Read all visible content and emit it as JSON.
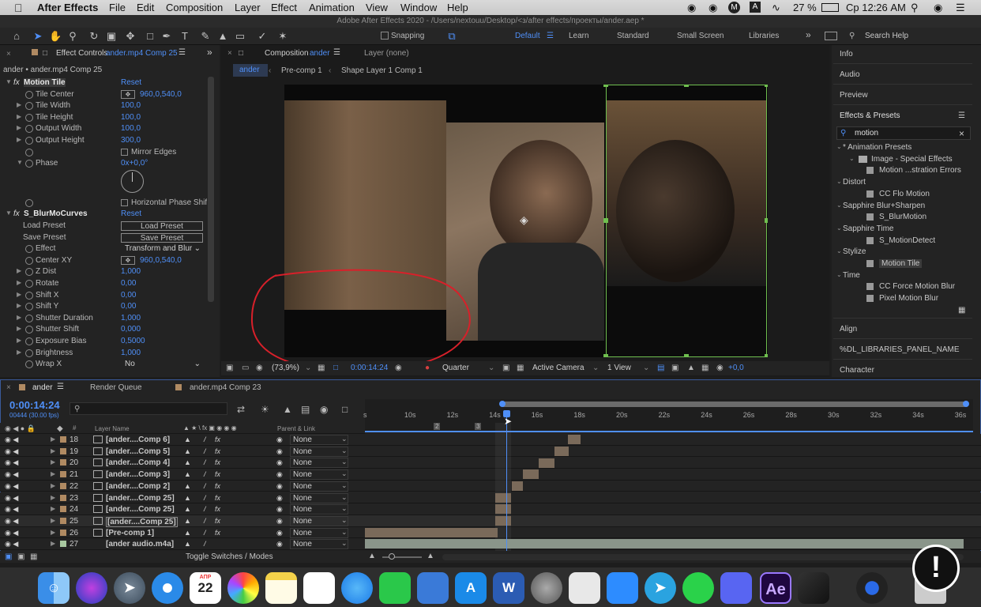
{
  "menubar": {
    "apple": "",
    "app": "After Effects",
    "items": [
      "File",
      "Edit",
      "Composition",
      "Layer",
      "Effect",
      "Animation",
      "View",
      "Window",
      "Help"
    ],
    "battery": "27 %",
    "clock": "Ср 12:26 AM",
    "m_icon": "M",
    "a_icon": "A"
  },
  "window_title": "Adobe After Effects 2020 - /Users/nextouu/Desktop/<з/after effects/проекты/ander.aep *",
  "toolbar": {
    "snapping": "Snapping",
    "workspaces": [
      "Default",
      "Learn",
      "Standard",
      "Small Screen",
      "Libraries"
    ],
    "active_workspace": "Default",
    "search_help": "Search Help"
  },
  "effect_controls": {
    "tab": "Effect Controls",
    "tab_file": "ander.mp4 Comp 25",
    "subtitle": "ander • ander.mp4 Comp 25",
    "fx1": {
      "name": "Motion Tile",
      "reset": "Reset",
      "props": [
        {
          "label": "Tile Center",
          "value": "960,0,540,0"
        },
        {
          "label": "Tile Width",
          "value": "100,0"
        },
        {
          "label": "Tile Height",
          "value": "100,0"
        },
        {
          "label": "Output Width",
          "value": "100,0"
        },
        {
          "label": "Output Height",
          "value": "300,0"
        },
        {
          "label": "Mirror Edges",
          "value": ""
        },
        {
          "label": "Phase",
          "value": "0x+0,0°"
        },
        {
          "label": "Horizontal Phase Shif",
          "value": ""
        }
      ]
    },
    "fx2": {
      "name": "S_BlurMoCurves",
      "reset": "Reset",
      "props": [
        {
          "label": "Load Preset",
          "value": "Load Preset"
        },
        {
          "label": "Save Preset",
          "value": "Save Preset"
        },
        {
          "label": "Effect",
          "value": "Transform and Blur"
        },
        {
          "label": "Center XY",
          "value": "960,0,540,0"
        },
        {
          "label": "Z Dist",
          "value": "1,000"
        },
        {
          "label": "Rotate",
          "value": "0,00"
        },
        {
          "label": "Shift X",
          "value": "0,00"
        },
        {
          "label": "Shift Y",
          "value": "0,00"
        },
        {
          "label": "Shutter Duration",
          "value": "1,000"
        },
        {
          "label": "Shutter Shift",
          "value": "0,000"
        },
        {
          "label": "Exposure Bias",
          "value": "0,5000"
        },
        {
          "label": "Brightness",
          "value": "1,000"
        },
        {
          "label": "Wrap X",
          "value": "No"
        }
      ]
    }
  },
  "composition": {
    "tab": "Composition",
    "tab_name": "ander",
    "layer_tab": "Layer (none)",
    "breadcrumbs": [
      "ander",
      "Pre-comp 1",
      "Shape Layer 1 Comp 1"
    ],
    "zoom": "(73,9%)",
    "timecode": "0:00:14:24",
    "resolution": "Quarter",
    "camera": "Active Camera",
    "views": "1 View",
    "exposure": "+0,0"
  },
  "right_panel": {
    "items": [
      "Info",
      "Audio",
      "Preview",
      "Effects & Presets",
      "Align",
      "%DL_LIBRARIES_PANEL_NAME",
      "Character"
    ],
    "search": "motion",
    "tree": [
      {
        "t": "* Animation Presets",
        "lvl": 0
      },
      {
        "t": "Image - Special Effects",
        "lvl": 1
      },
      {
        "t": "Motion ...stration Errors",
        "lvl": 2
      },
      {
        "t": "Distort",
        "lvl": 0
      },
      {
        "t": "CC Flo Motion",
        "lvl": 2
      },
      {
        "t": "Sapphire Blur+Sharpen",
        "lvl": 0
      },
      {
        "t": "S_BlurMotion",
        "lvl": 2
      },
      {
        "t": "Sapphire Time",
        "lvl": 0
      },
      {
        "t": "S_MotionDetect",
        "lvl": 2
      },
      {
        "t": "Stylize",
        "lvl": 0
      },
      {
        "t": "Motion Tile",
        "lvl": 2
      },
      {
        "t": "Time",
        "lvl": 0
      },
      {
        "t": "CC Force Motion Blur",
        "lvl": 2
      },
      {
        "t": "Pixel Motion Blur",
        "lvl": 2
      }
    ]
  },
  "timeline": {
    "tabs": [
      "ander",
      "Render Queue",
      "ander.mp4 Comp 23"
    ],
    "timecode": "0:00:14:24",
    "frames": "00444 (30.00 fps)",
    "col_layer": "Layer Name",
    "col_parent": "Parent & Link",
    "col_num": "#",
    "ruler": [
      "10s",
      "12s",
      "14s",
      "16s",
      "18s",
      "20s",
      "22s",
      "24s",
      "26s",
      "28s",
      "30s",
      "32s",
      "34s",
      "36s"
    ],
    "ruler_start": "s",
    "markers": [
      "2",
      "3"
    ],
    "layers": [
      {
        "num": "18",
        "name": "[ander....Comp 6]",
        "parent": "None",
        "color": "#b08a62"
      },
      {
        "num": "19",
        "name": "[ander....Comp 5]",
        "parent": "None",
        "color": "#b08a62"
      },
      {
        "num": "20",
        "name": "[ander....Comp 4]",
        "parent": "None",
        "color": "#b08a62"
      },
      {
        "num": "21",
        "name": "[ander....Comp 3]",
        "parent": "None",
        "color": "#b08a62"
      },
      {
        "num": "22",
        "name": "[ander....Comp 2]",
        "parent": "None",
        "color": "#b08a62"
      },
      {
        "num": "23",
        "name": "[ander....Comp 25]",
        "parent": "None",
        "color": "#b08a62"
      },
      {
        "num": "24",
        "name": "[ander....Comp 25]",
        "parent": "None",
        "color": "#b08a62"
      },
      {
        "num": "25",
        "name": "[ander....Comp 25]",
        "parent": "None",
        "color": "#b08a62"
      },
      {
        "num": "26",
        "name": "[Pre-comp 1]",
        "parent": "None",
        "color": "#b08a62"
      },
      {
        "num": "27",
        "name": "[ander audio.m4a]",
        "parent": "None",
        "color": "#a8c8a0"
      }
    ],
    "toggle": "Toggle Switches / Modes"
  },
  "dock": {
    "calendar_month": "АПР",
    "calendar_day": "22",
    "word": "W",
    "ae": "Ae"
  }
}
